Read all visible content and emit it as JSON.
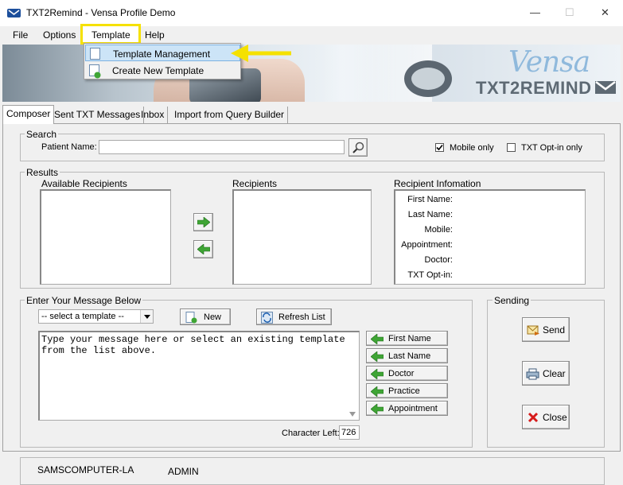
{
  "window": {
    "title": "TXT2Remind - Vensa Profile Demo",
    "minimize": "—",
    "maximize": "☐",
    "close": "✕"
  },
  "menu": [
    "File",
    "Options",
    "Template",
    "Help"
  ],
  "dropdown": {
    "items": [
      "Template Management",
      "Create New Template"
    ],
    "highlighted": "Template Management"
  },
  "banner": {
    "logo_top": "Vensa",
    "logo_bottom": "TXT2REMIND"
  },
  "tabs": [
    "Composer",
    "Sent TXT Messages",
    "Inbox",
    "Import from Query Builder"
  ],
  "search": {
    "group_label": "Search",
    "patient_label": "Patient Name:",
    "patient_value": "",
    "mobile_only_label": "Mobile only",
    "mobile_only_checked": true,
    "txt_optin_label": "TXT Opt-in only",
    "txt_optin_checked": false
  },
  "results": {
    "group_label": "Results",
    "available_label": "Available Recipients",
    "recipients_label": "Recipients",
    "info_label": "Recipient Infomation",
    "info_fields": [
      "First Name:",
      "Last Name:",
      "Mobile:",
      "Appointment:",
      "Doctor:",
      "TXT Opt-in:"
    ]
  },
  "message": {
    "group_label": "Enter Your Message Below",
    "template_select": "-- select a template --",
    "new_label": "New",
    "refresh_label": "Refresh List",
    "placeholder": "Type your message here or select an existing template from the list above.",
    "insert_buttons": [
      "First Name",
      "Last Name",
      "Doctor",
      "Practice",
      "Appointment"
    ],
    "char_left_label": "Character Left:",
    "char_left_value": "726"
  },
  "sending": {
    "group_label": "Sending",
    "send_label": "Send",
    "clear_label": "Clear",
    "close_label": "Close"
  },
  "footer": {
    "computer": "SAMSCOMPUTER-LA",
    "user": "ADMIN"
  },
  "colors": {
    "highlight_box": "#f5e100",
    "arrow": "#f5e100",
    "menu_selection": "#cce4f7",
    "green_arrow": "#3fa535"
  }
}
